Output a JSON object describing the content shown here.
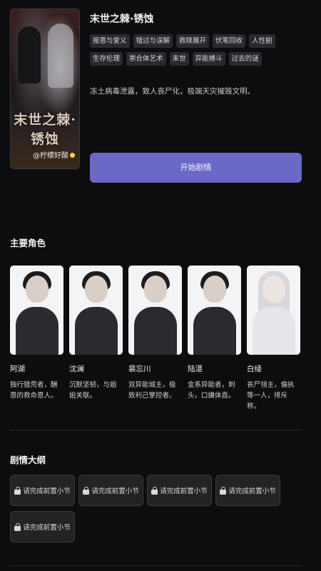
{
  "story": {
    "title": "末世之棘·锈蚀",
    "tags": [
      "报恩与爱义",
      "错过与误解",
      "救赎展开",
      "伏笔回收",
      "人性剧",
      "生存伦理",
      "崇合体艺术",
      "末世",
      "异能搏斗",
      "过去的谜"
    ],
    "description": "冻土病毒泄露，致人丧尸化，极端天灾摧毁文明。",
    "start_label": "开始剧情",
    "cover": {
      "title": "末世之棘·锈蚀",
      "author": "@柠檬好酸"
    }
  },
  "characters_section": {
    "title": "主要角色",
    "items": [
      {
        "name": "阿湖",
        "desc": "独行猎荒者，酬恩的救命恩人。",
        "tone": "dark"
      },
      {
        "name": "沈澜",
        "desc": "沉默坚韧，与姐姐关联。",
        "tone": "dark"
      },
      {
        "name": "裴忘川",
        "desc": "双异能城主，极致利己掌控者。",
        "tone": "dark"
      },
      {
        "name": "陆湛",
        "desc": "金系异能者，刺头，口嫌体直。",
        "tone": "dark"
      },
      {
        "name": "白绫",
        "desc": "丧尸领主，偏执等一人，排斥称。",
        "tone": "light"
      }
    ]
  },
  "outline_section": {
    "title": "剧情大纲",
    "items": [
      {
        "label": "请完成前置小节"
      },
      {
        "label": "请完成前置小节"
      },
      {
        "label": "请完成前置小节"
      },
      {
        "label": "请完成前置小节"
      },
      {
        "label": "请完成前置小节"
      }
    ]
  },
  "colors": {
    "accent": "#6b68c8",
    "background": "#0d0d10"
  }
}
